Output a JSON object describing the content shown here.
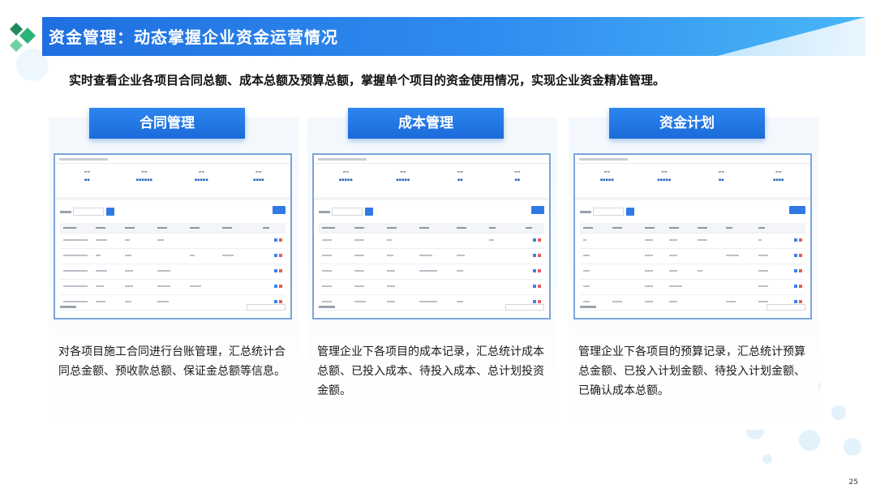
{
  "title": "资金管理：动态掌握企业资金运营情况",
  "subtitle": "实时查看企业各项目合同总额、成本总额及预算总额，掌握单个项目的资金使用情况，实现企业资金精准管理。",
  "page_number": "25",
  "columns": [
    {
      "header": "合同管理",
      "description": "对各项目施工合同进行台账管理，汇总统计合同总金额、预收款总额、保证金总额等信息。"
    },
    {
      "header": "成本管理",
      "description": "管理企业下各项目的成本记录，汇总统计成本总额、已投入成本、待投入成本、总计划投资金额。"
    },
    {
      "header": "资金计划",
      "description": "管理企业下各项目的预算记录，汇总统计预算总金额、已投入计划金额、待投入计划金额、已确认成本总额。"
    }
  ],
  "colors": {
    "accent": "#1f6fe0",
    "title_text": "#ffffff",
    "header_bg": "#2d86ef"
  }
}
